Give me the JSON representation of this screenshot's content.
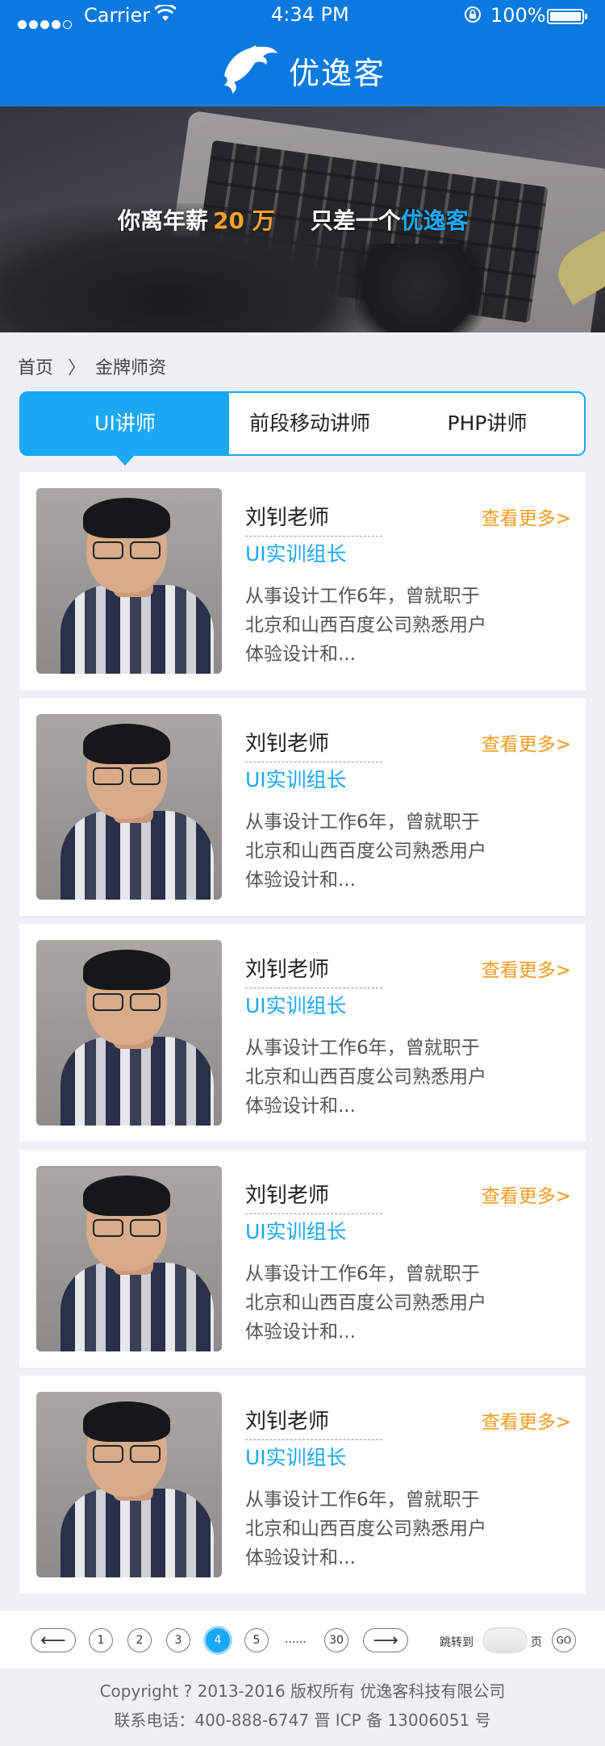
{
  "status_bar": {
    "carrier": "Carrier",
    "time": "4:34 PM",
    "battery": "100%"
  },
  "nav": {
    "brand": "优逸客"
  },
  "banner": {
    "text_before": "你离年薪",
    "number": "20 万",
    "text_middle": "只差一个",
    "highlight": "优逸客"
  },
  "breadcrumb": {
    "home": "首页",
    "separator": "〉",
    "current": "金牌师资"
  },
  "tabs": [
    {
      "label": "UI讲师",
      "active": true
    },
    {
      "label": "前段移动讲师",
      "active": false
    },
    {
      "label": "PHP讲师",
      "active": false
    }
  ],
  "teachers": [
    {
      "name": "刘钊老师",
      "more": "查看更多>",
      "role": "UI实训组长",
      "desc": "从事设计工作6年，曾就职于北京和山西百度公司熟悉用户体验设计和..."
    },
    {
      "name": "刘钊老师",
      "more": "查看更多>",
      "role": "UI实训组长",
      "desc": "从事设计工作6年，曾就职于北京和山西百度公司熟悉用户体验设计和..."
    },
    {
      "name": "刘钊老师",
      "more": "查看更多>",
      "role": "UI实训组长",
      "desc": "从事设计工作6年，曾就职于北京和山西百度公司熟悉用户体验设计和..."
    },
    {
      "name": "刘钊老师",
      "more": "查看更多>",
      "role": "UI实训组长",
      "desc": "从事设计工作6年，曾就职于北京和山西百度公司熟悉用户体验设计和..."
    },
    {
      "name": "刘钊老师",
      "more": "查看更多>",
      "role": "UI实训组长",
      "desc": "从事设计工作6年，曾就职于北京和山西百度公司熟悉用户体验设计和..."
    }
  ],
  "pagination": {
    "prev": "⟵",
    "pages": [
      "1",
      "2",
      "3",
      "4",
      "5"
    ],
    "active_page": "4",
    "ellipsis": "......",
    "last": "30",
    "next": "⟶",
    "jump_label": "跳转到",
    "page_unit": "页",
    "go": "GO"
  },
  "footer": {
    "copyright": "Copyright ? 2013-2016 版权所有 优逸客科技有限公司",
    "contact": "联系电话：400-888-6747 晋 ICP 备 13006051 号"
  },
  "colors": {
    "primary": "#0a7ae0",
    "accent": "#1aa8f5",
    "orange": "#f39a1f"
  }
}
